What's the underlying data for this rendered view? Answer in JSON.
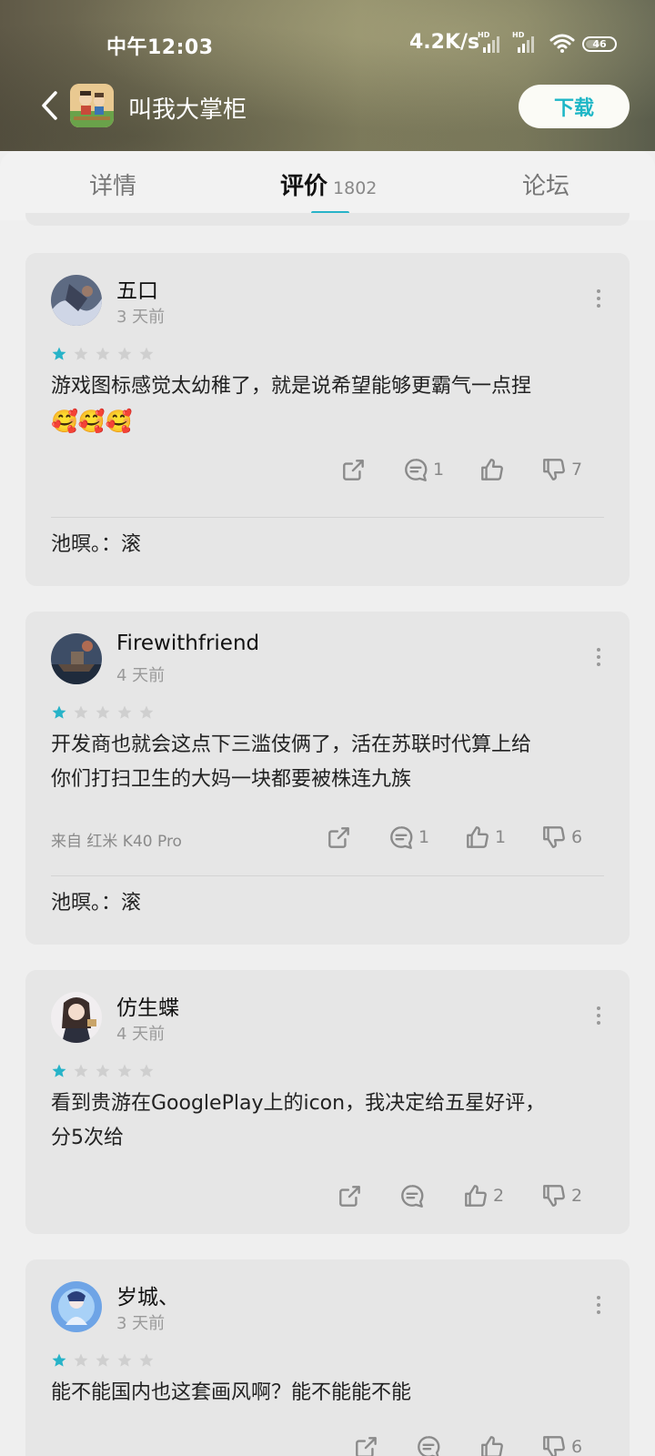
{
  "status_bar": {
    "time": "中午12:03",
    "net_speed": "4.2K/s",
    "signal_label": "HD",
    "battery": "46"
  },
  "header": {
    "app_title": "叫我大掌柜",
    "download_label": "下载"
  },
  "tabs": [
    {
      "label": "详情"
    },
    {
      "label": "评价",
      "count": "1802"
    },
    {
      "label": "论坛"
    }
  ],
  "reviews": [
    {
      "user": "五口",
      "time": "3 天前",
      "rating": 1,
      "content": "游戏图标感觉太幼稚了，就是说希望能够更霸气一点捏",
      "emoji": "🥰🥰🥰",
      "device": "",
      "comments": "1",
      "likes": "",
      "dislikes": "7",
      "reply_user": "池暝。",
      "reply_sep": "：",
      "reply_text": "滚"
    },
    {
      "user": "Firewithfriend",
      "time": "4 天前",
      "rating": 1,
      "content_line1": "开发商也就会这点下三滥伎俩了，活在苏联时代算上给",
      "content_line2": "你们打扫卫生的大妈一块都要被株连九族",
      "device": "来自 红米 K40 Pro",
      "comments": "1",
      "likes": "1",
      "dislikes": "6",
      "reply_user": "池暝。",
      "reply_sep": "：",
      "reply_text": "滚"
    },
    {
      "user": "仿生蝶",
      "time": "4 天前",
      "rating": 1,
      "content_line1": "看到贵游在GooglePlay上的icon，我决定给五星好评，",
      "content_line2": "分5次给",
      "comments": "",
      "likes": "2",
      "dislikes": "2"
    },
    {
      "user": "岁城、",
      "time": "3 天前",
      "rating": 1,
      "content": "能不能国内也这套画风啊？能不能能不能",
      "dislikes": "6"
    }
  ],
  "colors": {
    "accent": "#27b3c8",
    "star_on": "#27b3c8",
    "star_off": "#cfcfcf",
    "card_bg": "#e6e6e6"
  }
}
